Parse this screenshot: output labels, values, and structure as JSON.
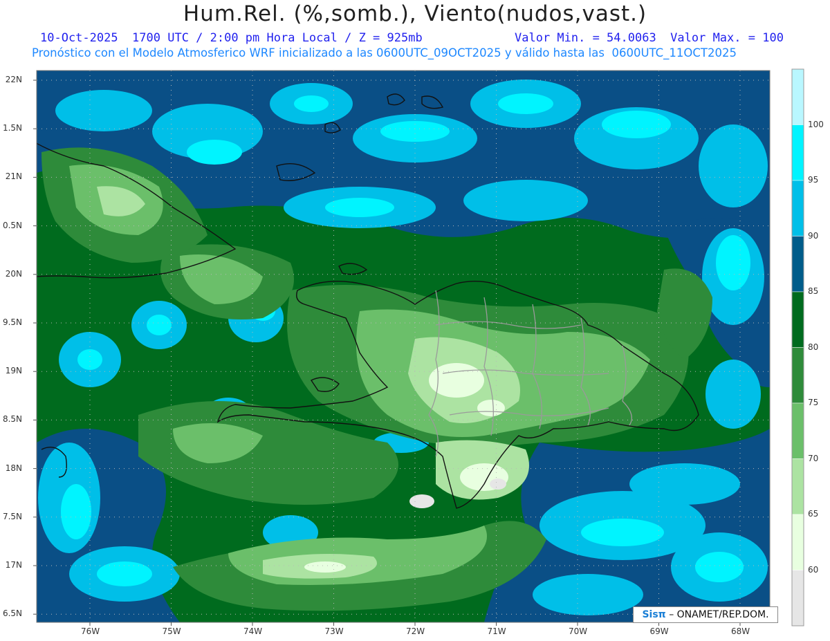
{
  "header": {
    "title": "Hum.Rel. (%,somb.), Viento(nudos,vast.)",
    "line1_left": "10-Oct-2025  1700 UTC / 2:00 pm Hora Local / Z = 925mb",
    "line1_right": "Valor Min. = 54.0063  Valor Max. = 100",
    "line2": "Pronóstico con el Modelo Atmosferico WRF inicializado a las 0600UTC_09OCT2025 y válido hasta las  0600UTC_11OCT2025"
  },
  "axes": {
    "lat_labels": [
      "22N",
      "1.5N",
      "21N",
      "0.5N",
      "20N",
      "9.5N",
      "19N",
      "8.5N",
      "18N",
      "7.5N",
      "17N",
      "6.5N"
    ],
    "lon_labels": [
      "76W",
      "75W",
      "74W",
      "73W",
      "72W",
      "71W",
      "70W",
      "69W",
      "68W"
    ]
  },
  "colorbar": {
    "labels": [
      "100",
      "95",
      "90",
      "85",
      "80",
      "75",
      "70",
      "65",
      "60"
    ],
    "colors": [
      "#b9f7ff",
      "#00f4ff",
      "#00bfe8",
      "#005c8a",
      "#006b1e",
      "#2e8b3a",
      "#6bbf6a",
      "#ace3a2",
      "#e8ffe0",
      "#e6e6e6"
    ]
  },
  "credit": {
    "brand": "Sisπ",
    "text": " – ONAMET/REP.DOM."
  }
}
